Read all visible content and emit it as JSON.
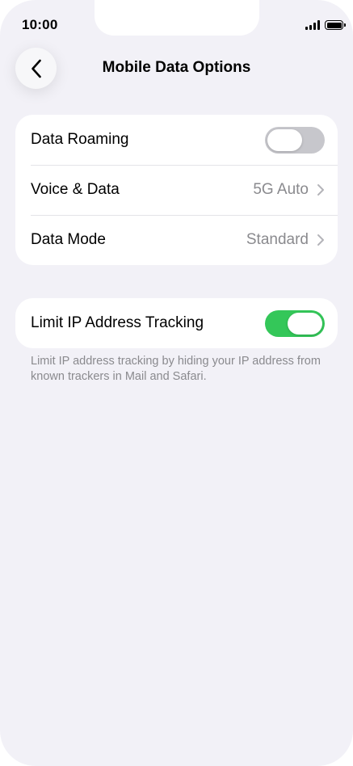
{
  "status_bar": {
    "time": "10:00",
    "signal_icon": "cellular-signal-icon",
    "battery_icon": "battery-full-icon"
  },
  "nav": {
    "back_icon": "chevron-left-icon",
    "title": "Mobile Data Options"
  },
  "settings_group": {
    "rows": [
      {
        "label": "Data Roaming",
        "control": "toggle",
        "state": "off"
      },
      {
        "label": "Voice & Data",
        "value": "5G Auto",
        "control": "disclosure"
      },
      {
        "label": "Data Mode",
        "value": "Standard",
        "control": "disclosure"
      }
    ]
  },
  "privacy_group": {
    "label": "Limit IP Address Tracking",
    "control": "toggle",
    "state": "on",
    "footnote": "Limit IP address tracking by hiding your IP address from known trackers in Mail and Safari."
  },
  "colors": {
    "background": "#f2f1f7",
    "card": "#ffffff",
    "toggle_on": "#34c759",
    "toggle_off": "#c7c7cc",
    "secondary_text": "#8a8a8e"
  }
}
